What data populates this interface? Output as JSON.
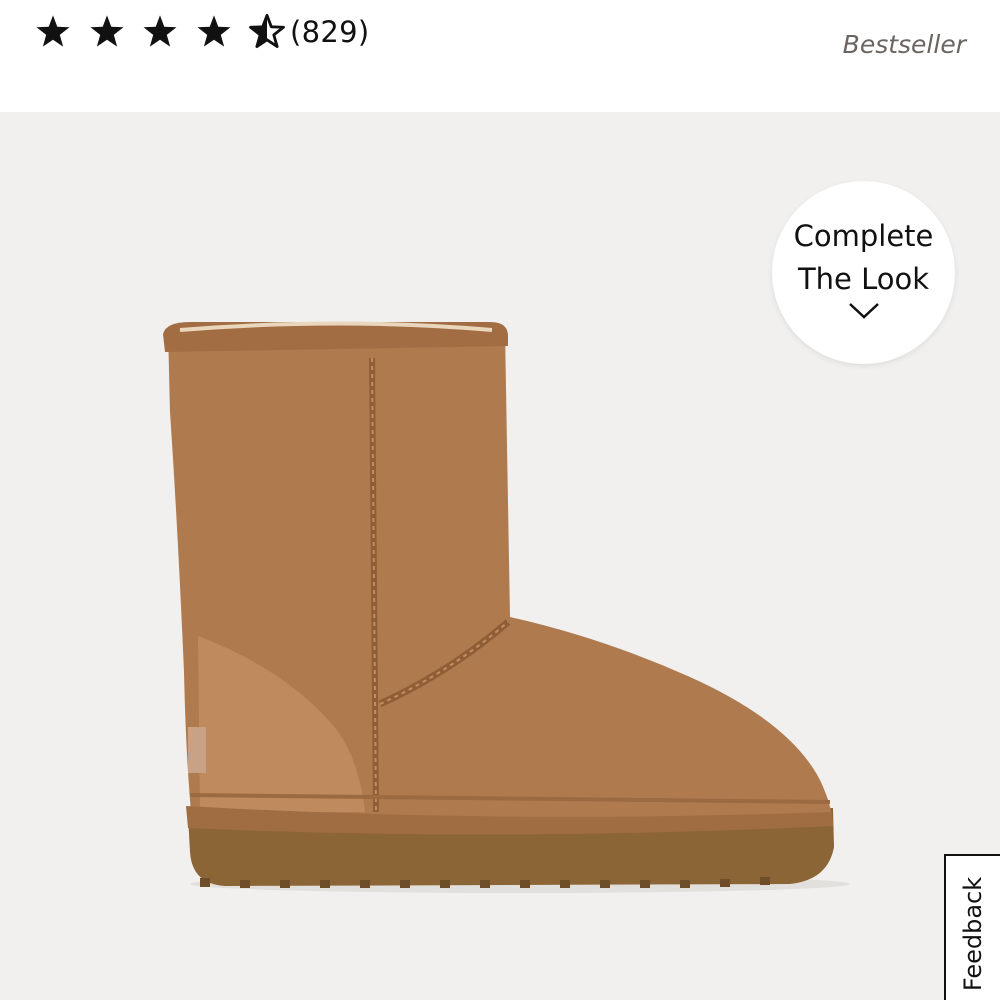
{
  "rating": {
    "stars": 4.5,
    "max_stars": 5,
    "review_count": "(829)"
  },
  "badge": "Bestseller",
  "product_image": {
    "name": "boot-image"
  },
  "complete_the_look": {
    "line1": "Complete",
    "line2": "The Look",
    "icon": "chevron-down-icon"
  },
  "feedback_tab": {
    "label": "Feedback"
  },
  "colors": {
    "hero_bg": "#f1f0ee",
    "suede": "#b07a4f",
    "sole": "#8c6536",
    "badge_text": "#6b645f"
  }
}
